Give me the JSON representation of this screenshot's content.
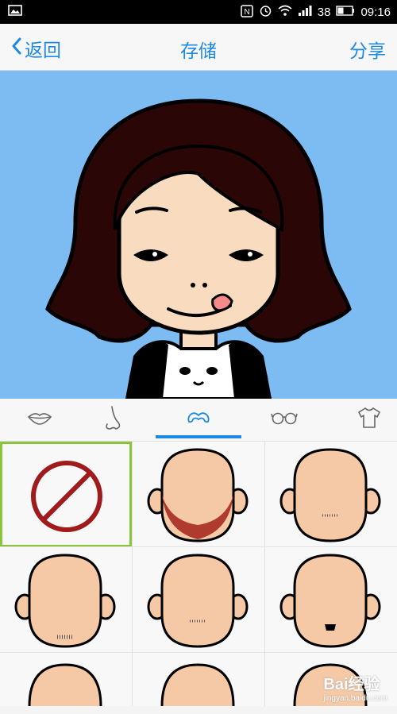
{
  "status_bar": {
    "battery_level": "38",
    "time": "09:16"
  },
  "nav": {
    "back_label": "返回",
    "title": "存储",
    "share_label": "分享"
  },
  "category_tabs": [
    {
      "icon": "lips-icon",
      "selected": false
    },
    {
      "icon": "nose-icon",
      "selected": false
    },
    {
      "icon": "mustache-icon",
      "selected": true
    },
    {
      "icon": "glasses-icon",
      "selected": false
    },
    {
      "icon": "shirt-icon",
      "selected": false
    }
  ],
  "beard_options": [
    {
      "icon": "none-icon",
      "selected": true
    },
    {
      "icon": "red-full-beard-icon",
      "selected": false
    },
    {
      "icon": "chin-stubble-icon",
      "selected": false
    },
    {
      "icon": "goatee-stubble-icon",
      "selected": false
    },
    {
      "icon": "chin-stubble-icon",
      "selected": false
    },
    {
      "icon": "soul-patch-icon",
      "selected": false
    }
  ],
  "watermark": {
    "brand": "Bai经验",
    "url": "jingyan.baidu.com"
  },
  "colors": {
    "accent": "#1e88e5",
    "avatar_background": "#7cbcf3",
    "selected_border": "#8cc43c",
    "hair": "#2a0606",
    "skin": "#f9dcc0"
  }
}
